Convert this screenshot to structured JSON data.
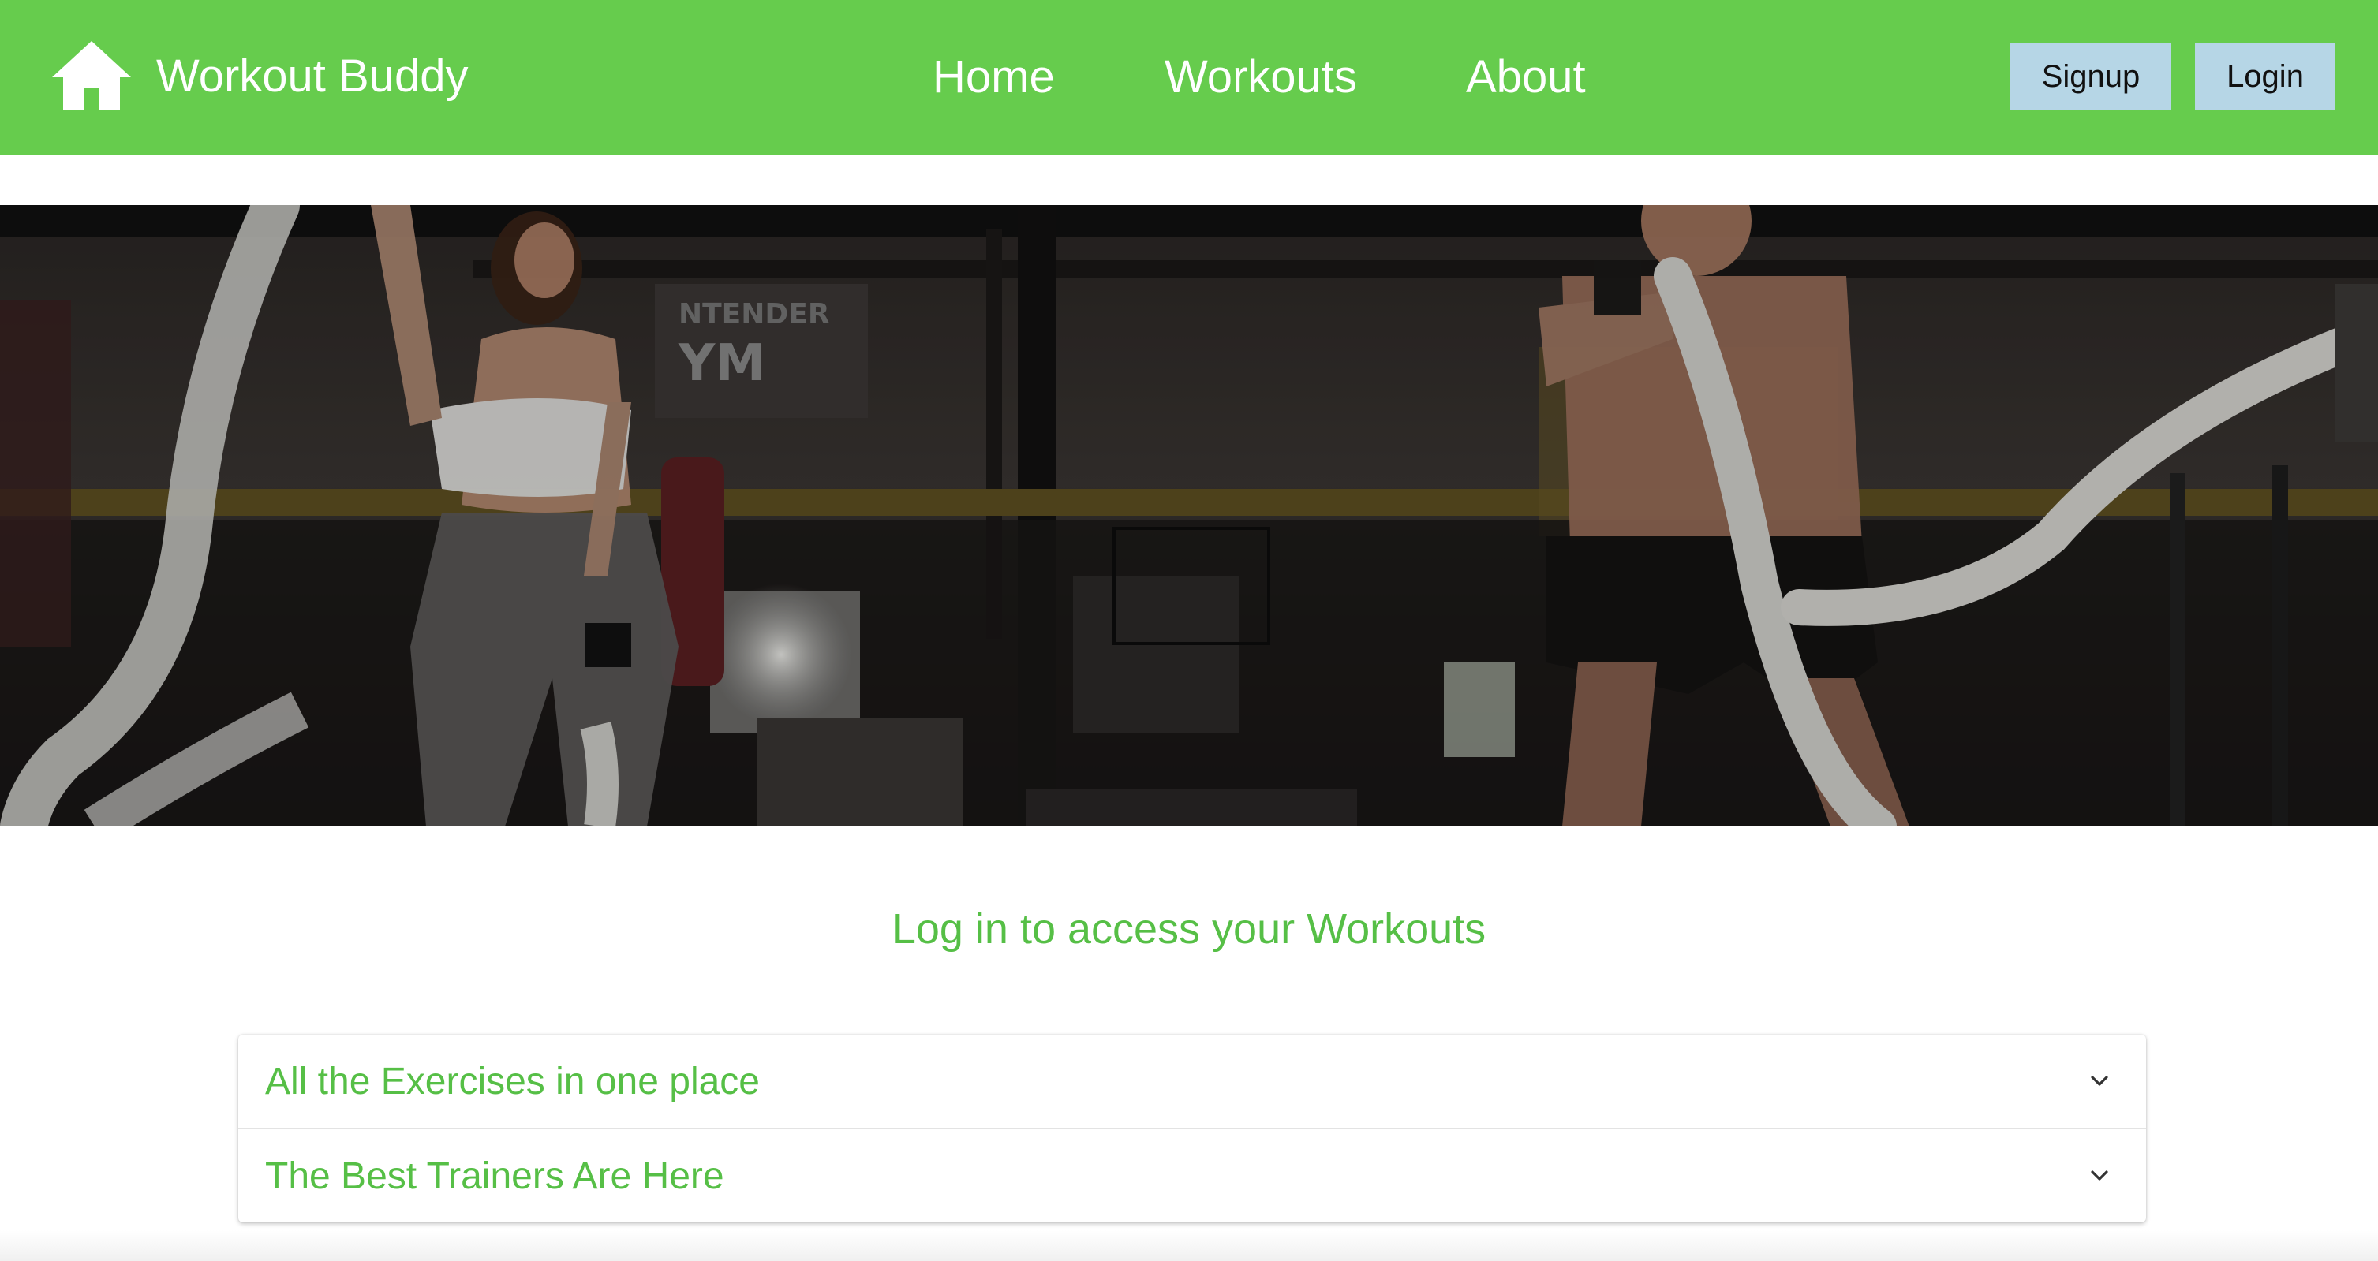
{
  "colors": {
    "navbar_bg": "#66cc4d",
    "accent_green": "#56bf46",
    "button_bg": "#b6d6e6"
  },
  "navbar": {
    "brand_icon": "home-icon",
    "brand_text": "Workout Buddy",
    "links": [
      "Home",
      "Workouts",
      "About"
    ],
    "signup_label": "Signup",
    "login_label": "Login"
  },
  "hero": {
    "slide_count": 4,
    "active_slide": 1
  },
  "cta": {
    "text": "Log in to access your Workouts"
  },
  "accordion": {
    "items": [
      {
        "title": "All the Exercises in one place",
        "icon": "chevron-down-icon"
      },
      {
        "title": "The Best Trainers Are Here",
        "icon": "chevron-down-icon"
      }
    ]
  }
}
